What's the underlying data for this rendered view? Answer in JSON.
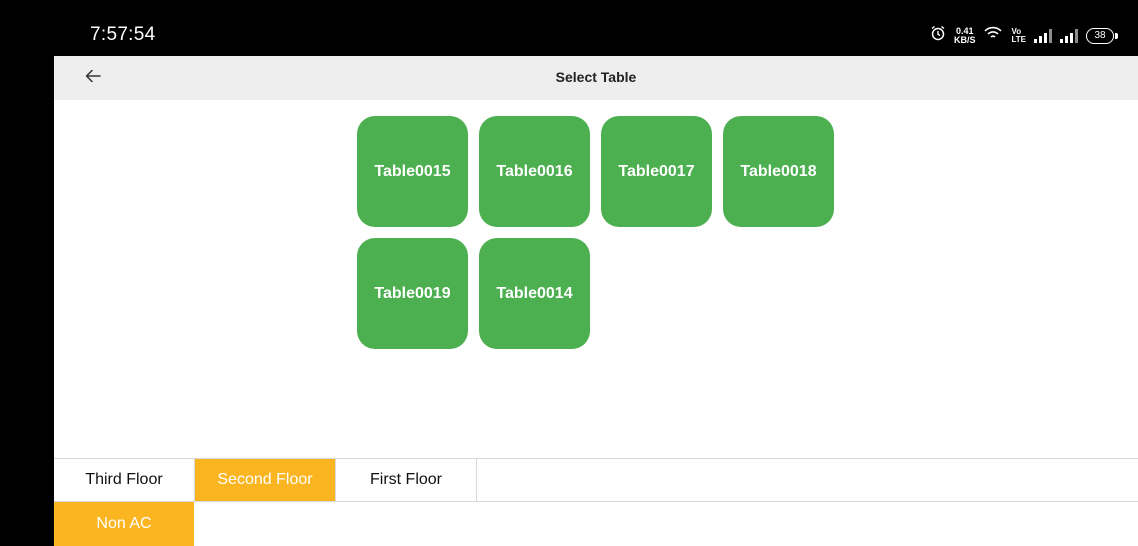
{
  "status_bar": {
    "time": "7:57:54",
    "net_speed_value": "0.41",
    "net_speed_unit": "KB/S",
    "volte_top": "Vo",
    "volte_bottom": "LTE",
    "battery": "38",
    "icons": [
      "alarm-icon",
      "wifi-icon",
      "volte-icon",
      "signal-icon",
      "signal-icon",
      "battery-icon"
    ]
  },
  "app_bar": {
    "title": "Select Table",
    "back_icon": "arrow-left-icon"
  },
  "tables": [
    {
      "label": "Table0015"
    },
    {
      "label": "Table0016"
    },
    {
      "label": "Table0017"
    },
    {
      "label": "Table0018"
    },
    {
      "label": "Table0019"
    },
    {
      "label": "Table0014"
    }
  ],
  "floor_tabs": [
    {
      "label": "Third Floor",
      "active": false
    },
    {
      "label": "Second Floor",
      "active": true
    },
    {
      "label": "First Floor",
      "active": false
    }
  ],
  "section_tabs": [
    {
      "label": "Non AC",
      "active": true
    }
  ],
  "colors": {
    "tile_green": "#4caf50",
    "active_orange": "#fbb520",
    "app_bar_bg": "#eeeeee"
  }
}
